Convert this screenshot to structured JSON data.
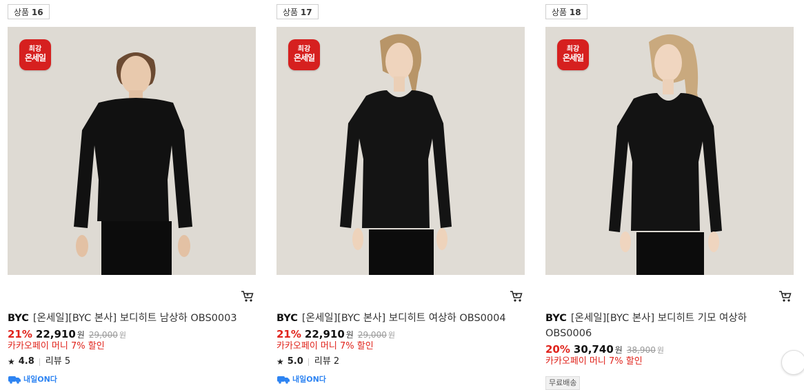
{
  "products": [
    {
      "badge_prefix": "상품",
      "badge_num": "16",
      "sale_badge_line1": "최강",
      "sale_badge_line2": "온세일",
      "brand": "BYC",
      "name": "[온세일][BYC 본사] 보디히트 남상하 OBS0003",
      "discount": "21%",
      "price": "22,910",
      "won": "원",
      "original_price": "29,000",
      "original_won": "원",
      "promo": "카카오페이 머니 7% 할인",
      "rating": "4.8",
      "review_label": "리뷰 5",
      "delivery_label": "내일ON다"
    },
    {
      "badge_prefix": "상품",
      "badge_num": "17",
      "sale_badge_line1": "최강",
      "sale_badge_line2": "온세일",
      "brand": "BYC",
      "name": "[온세일][BYC 본사] 보디히트 여상하 OBS0004",
      "discount": "21%",
      "price": "22,910",
      "won": "원",
      "original_price": "29,000",
      "original_won": "원",
      "promo": "카카오페이 머니 7% 할인",
      "rating": "5.0",
      "review_label": "리뷰 2",
      "delivery_label": "내일ON다"
    },
    {
      "badge_prefix": "상품",
      "badge_num": "18",
      "sale_badge_line1": "최강",
      "sale_badge_line2": "온세일",
      "brand": "BYC",
      "name": "[온세일][BYC 본사] 보디히트 기모 여상하 OBS0006",
      "discount": "20%",
      "price": "30,740",
      "won": "원",
      "original_price": "38,900",
      "original_won": "원",
      "promo": "카카오페이 머니 7% 할인",
      "free_shipping": "무료배송"
    }
  ],
  "colors": {
    "accent_red": "#e0231b",
    "badge_red": "#d6201f",
    "delivery_blue": "#2e84f2"
  },
  "icons": [
    "cart-icon",
    "star-icon",
    "truck-icon"
  ]
}
